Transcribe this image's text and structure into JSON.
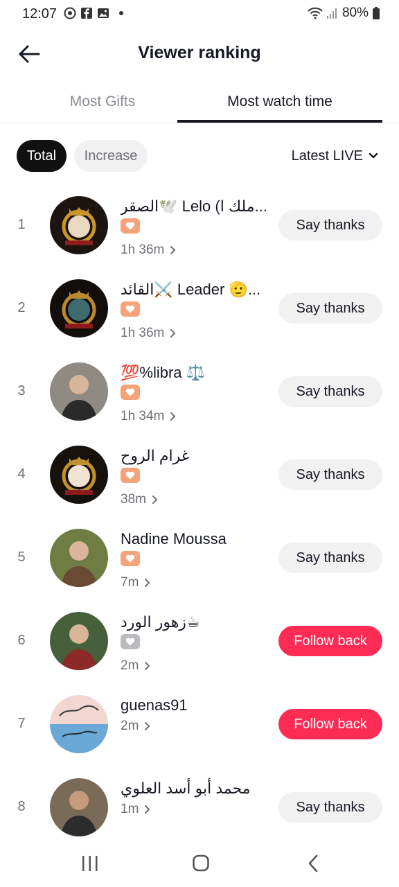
{
  "status_bar": {
    "time": "12:07",
    "left_icons": [
      "whatsapp-icon",
      "facebook-icon",
      "gallery-icon",
      "notification-dot"
    ],
    "battery": "80%"
  },
  "header": {
    "back_icon": "arrow-left-icon",
    "title": "Viewer ranking"
  },
  "tabs": [
    {
      "label": "Most Gifts",
      "active": false
    },
    {
      "label": "Most watch time",
      "active": true
    }
  ],
  "filters": {
    "chips": [
      {
        "label": "Total",
        "active": true
      },
      {
        "label": "Increase",
        "active": false
      }
    ],
    "dropdown": "Latest LIVE"
  },
  "viewers": [
    {
      "rank": "1",
      "name": "الصقر🕊️ Lelo (ملك ا...",
      "badge": "orange",
      "duration": "1h 36m",
      "action": "Say thanks"
    },
    {
      "rank": "2",
      "name": "القائد⚔️ Leader 🫡...",
      "badge": "orange",
      "duration": "1h 36m",
      "action": "Say thanks"
    },
    {
      "rank": "3",
      "name": "💯%libra ⚖️",
      "badge": "orange",
      "duration": "1h 34m",
      "action": "Say thanks"
    },
    {
      "rank": "4",
      "name": "غرام الروح",
      "badge": "orange",
      "duration": "38m",
      "action": "Say thanks"
    },
    {
      "rank": "5",
      "name": "Nadine Moussa",
      "badge": "orange",
      "duration": "7m",
      "action": "Say thanks"
    },
    {
      "rank": "6",
      "name": "زهور الورد☕",
      "badge": "grey",
      "duration": "2m",
      "action": "Follow back"
    },
    {
      "rank": "7",
      "name": "guenas91",
      "badge": "",
      "duration": "2m",
      "action": "Follow back"
    },
    {
      "rank": "8",
      "name": "محمد أبو أسد العلوي",
      "badge": "",
      "duration": "1m",
      "action": "Say thanks"
    }
  ],
  "colors": {
    "accent": "#fe2c55",
    "badge_orange": "#f6a27a",
    "badge_grey": "#b9bbbe",
    "chip_bg": "#f1f1f2"
  },
  "nav_bar": {
    "icons": [
      "recent-apps-icon",
      "home-icon",
      "back-icon"
    ]
  }
}
